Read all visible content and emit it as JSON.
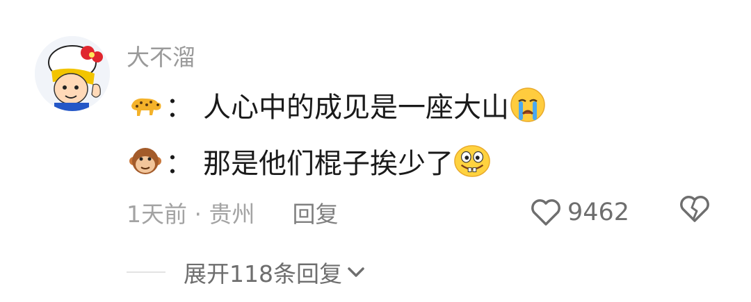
{
  "comment": {
    "username": "大不溜",
    "lines": [
      {
        "emoji": "leopard-emoji",
        "colon": "：",
        "text": "人心中的成见是一座大山",
        "trailing_emoji": "crying-emoji"
      },
      {
        "emoji": "monkey-emoji",
        "colon": "：",
        "text": "那是他们棍子挨少了",
        "trailing_emoji": "buck-teeth-emoji"
      }
    ],
    "time_location": "1天前 · 贵州",
    "reply_label": "回复",
    "like_count": "9462"
  },
  "expand_replies": {
    "label": "展开118条回复",
    "icon": "chevron-down-icon"
  },
  "colors": {
    "name": "#9a9a9a",
    "text": "#1a1a1a",
    "meta": "#a3a3a3",
    "icon": "#6e6e6e"
  }
}
